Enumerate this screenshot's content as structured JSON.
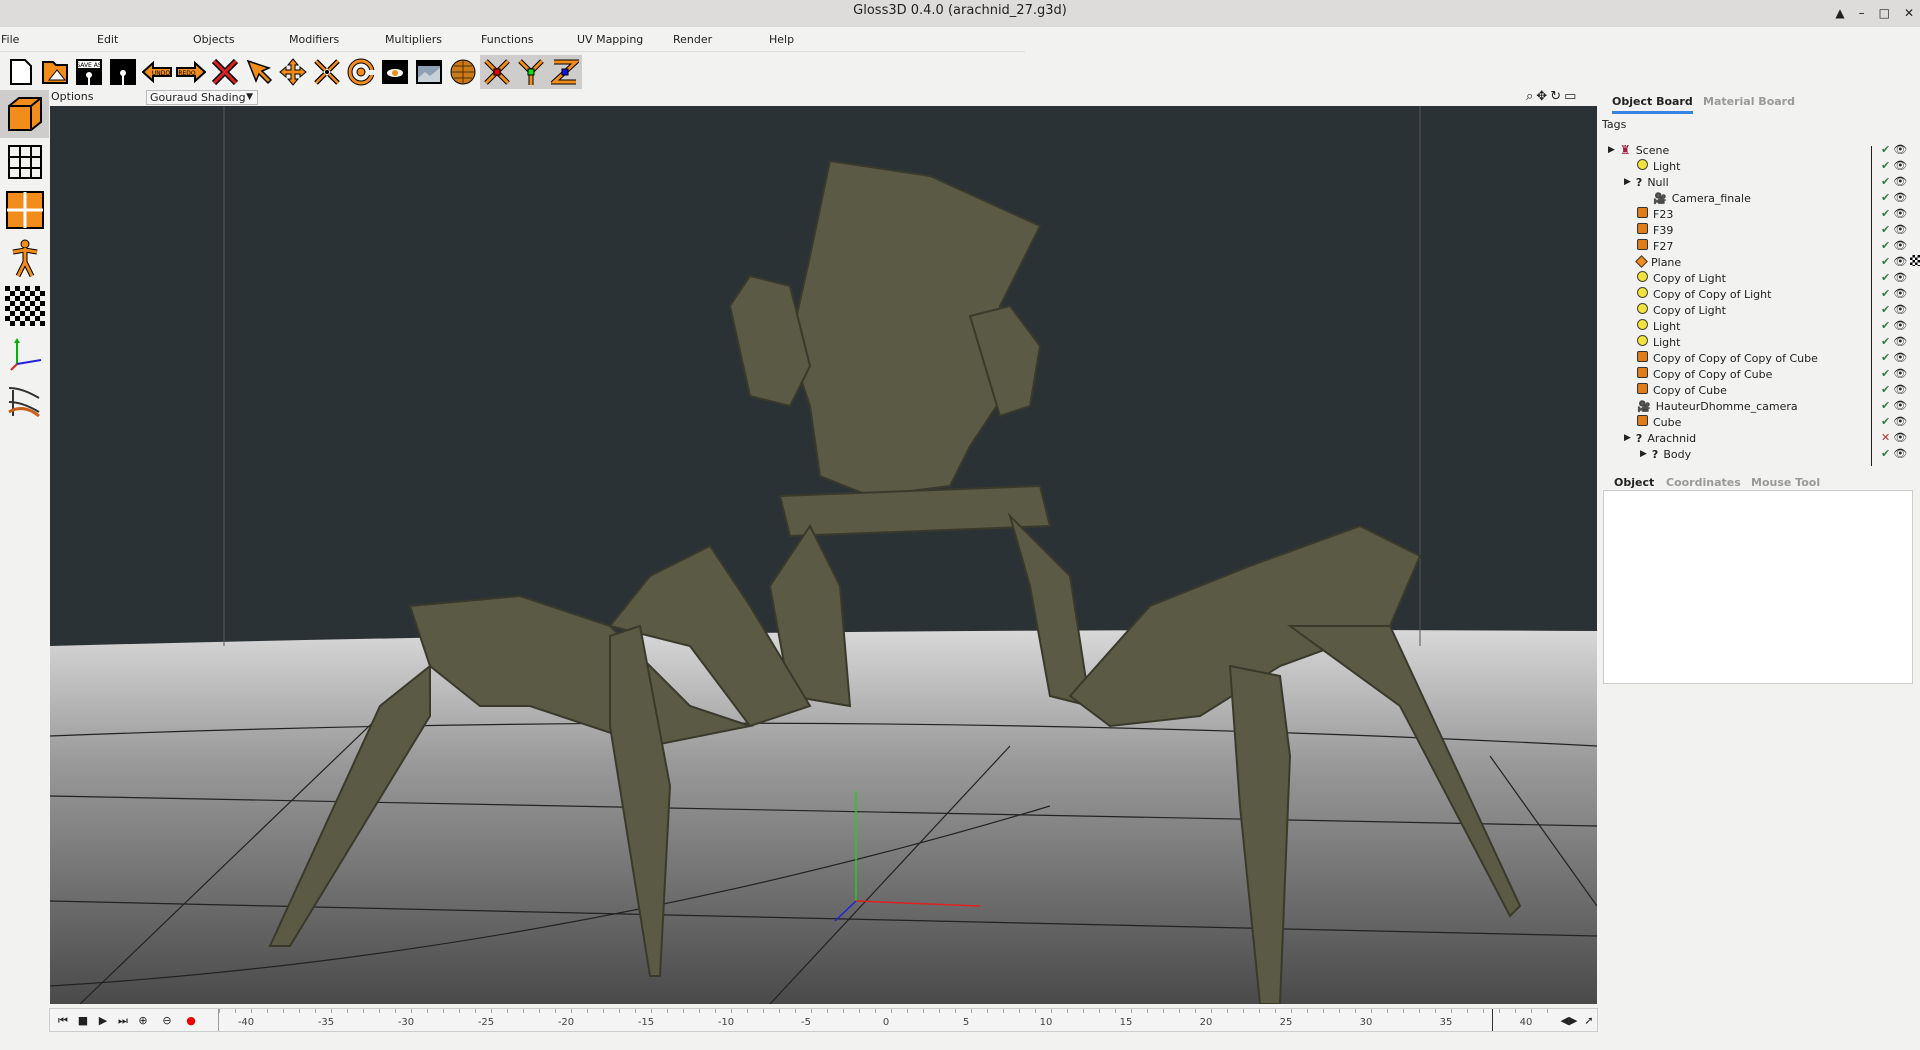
{
  "window": {
    "title": "Gloss3D 0.4.0 (arachnid_27.g3d)",
    "controls": [
      "▲",
      "–",
      "□",
      "✕"
    ]
  },
  "menu": [
    "File",
    "Edit",
    "Objects",
    "Modifiers",
    "Multipliers",
    "Functions",
    "UV Mapping",
    "Render",
    "Help"
  ],
  "toolbar": [
    {
      "icon": "new-file-icon"
    },
    {
      "icon": "open-folder-icon"
    },
    {
      "icon": "save-as-icon",
      "text": "SAVE AS"
    },
    {
      "icon": "save-icon"
    },
    {
      "icon": "undo-icon",
      "text": "UNDO"
    },
    {
      "icon": "redo-icon",
      "text": "REDO"
    },
    {
      "icon": "delete-icon"
    },
    {
      "icon": "pick-icon"
    },
    {
      "icon": "move-icon"
    },
    {
      "icon": "scale-icon"
    },
    {
      "icon": "rotate-icon"
    },
    {
      "icon": "render-view-icon"
    },
    {
      "icon": "render-final-icon"
    },
    {
      "icon": "globe-icon"
    },
    {
      "icon": "axis-x-icon"
    },
    {
      "icon": "axis-y-icon"
    },
    {
      "icon": "axis-z-icon"
    }
  ],
  "left_tools": [
    "object-mode-icon",
    "vertex-mode-icon",
    "face-mode-icon",
    "skeleton-mode-icon",
    "uv-mode-icon",
    "axis-mode-icon",
    "sculpt-mode-icon"
  ],
  "viewport": {
    "options_label": "Options",
    "shading": "Gouraud Shading",
    "background": "#2b3236"
  },
  "timeline": {
    "ticks": [
      "-40",
      "-35",
      "-30",
      "-25",
      "-20",
      "-15",
      "-10",
      "-5",
      "0",
      "5",
      "10",
      "15",
      "20",
      "25",
      "30",
      "35",
      "40"
    ],
    "current_frame": 38
  },
  "right_panel": {
    "tabs": [
      {
        "label": "Object Board",
        "active": true
      },
      {
        "label": "Material Board",
        "active": false
      }
    ],
    "tags_label": "Tags",
    "tree": [
      {
        "name": "Scene",
        "type": "scene",
        "depth": 0,
        "expander": true,
        "active": true
      },
      {
        "name": "Light",
        "type": "light",
        "depth": 1,
        "active": true
      },
      {
        "name": "Null",
        "type": "null",
        "depth": 1,
        "expander": true,
        "active": true
      },
      {
        "name": "Camera_finale",
        "type": "camera",
        "depth": 2,
        "active": true
      },
      {
        "name": "F23",
        "type": "mesh",
        "depth": 1,
        "active": true
      },
      {
        "name": "F39",
        "type": "mesh",
        "depth": 1,
        "active": true
      },
      {
        "name": "F27",
        "type": "mesh",
        "depth": 1,
        "active": true
      },
      {
        "name": "Plane",
        "type": "plane",
        "depth": 1,
        "active": true,
        "tag": true
      },
      {
        "name": "Copy of Light",
        "type": "light",
        "depth": 1,
        "active": true
      },
      {
        "name": "Copy of Copy of Light",
        "type": "light",
        "depth": 1,
        "active": true
      },
      {
        "name": "Copy of Light",
        "type": "light",
        "depth": 1,
        "active": true
      },
      {
        "name": "Light",
        "type": "light",
        "depth": 1,
        "active": true
      },
      {
        "name": "Light",
        "type": "light",
        "depth": 1,
        "active": true
      },
      {
        "name": "Copy of Copy of Copy of Cube",
        "type": "mesh",
        "depth": 1,
        "active": true
      },
      {
        "name": "Copy of Copy of Cube",
        "type": "mesh",
        "depth": 1,
        "active": true
      },
      {
        "name": "Copy of Cube",
        "type": "mesh",
        "depth": 1,
        "active": true
      },
      {
        "name": "HauteurDhomme_camera",
        "type": "camera",
        "depth": 1,
        "active": true
      },
      {
        "name": "Cube",
        "type": "mesh",
        "depth": 1,
        "active": true
      },
      {
        "name": "Arachnid",
        "type": "null",
        "depth": 1,
        "expander": true,
        "active": false
      },
      {
        "name": "Body",
        "type": "null",
        "depth": 2,
        "expander": true,
        "active": true
      }
    ],
    "bottom_tabs": [
      {
        "label": "Object",
        "active": true
      },
      {
        "label": "Coordinates",
        "active": false
      },
      {
        "label": "Mouse Tool",
        "active": false
      }
    ]
  }
}
